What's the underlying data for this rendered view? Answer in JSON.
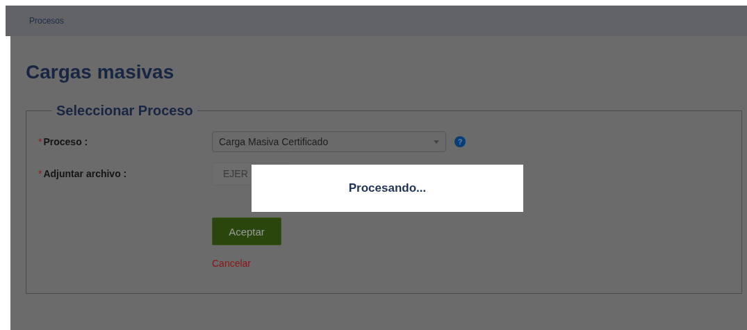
{
  "breadcrumb": {
    "text": "Procesos"
  },
  "title": "Cargas masivas",
  "fieldset": {
    "legend": "Seleccionar Proceso",
    "fields": [
      {
        "kind": "select",
        "mark": "*",
        "label": "Proceso :",
        "value": "Carga Masiva Certificado",
        "help": "?"
      },
      {
        "kind": "file",
        "mark": "*",
        "label": "Adjuntar archivo :",
        "value": "EJER"
      }
    ],
    "submit": "Aceptar",
    "cancel": "Cancelar"
  },
  "modal": {
    "message": "Procesando..."
  }
}
